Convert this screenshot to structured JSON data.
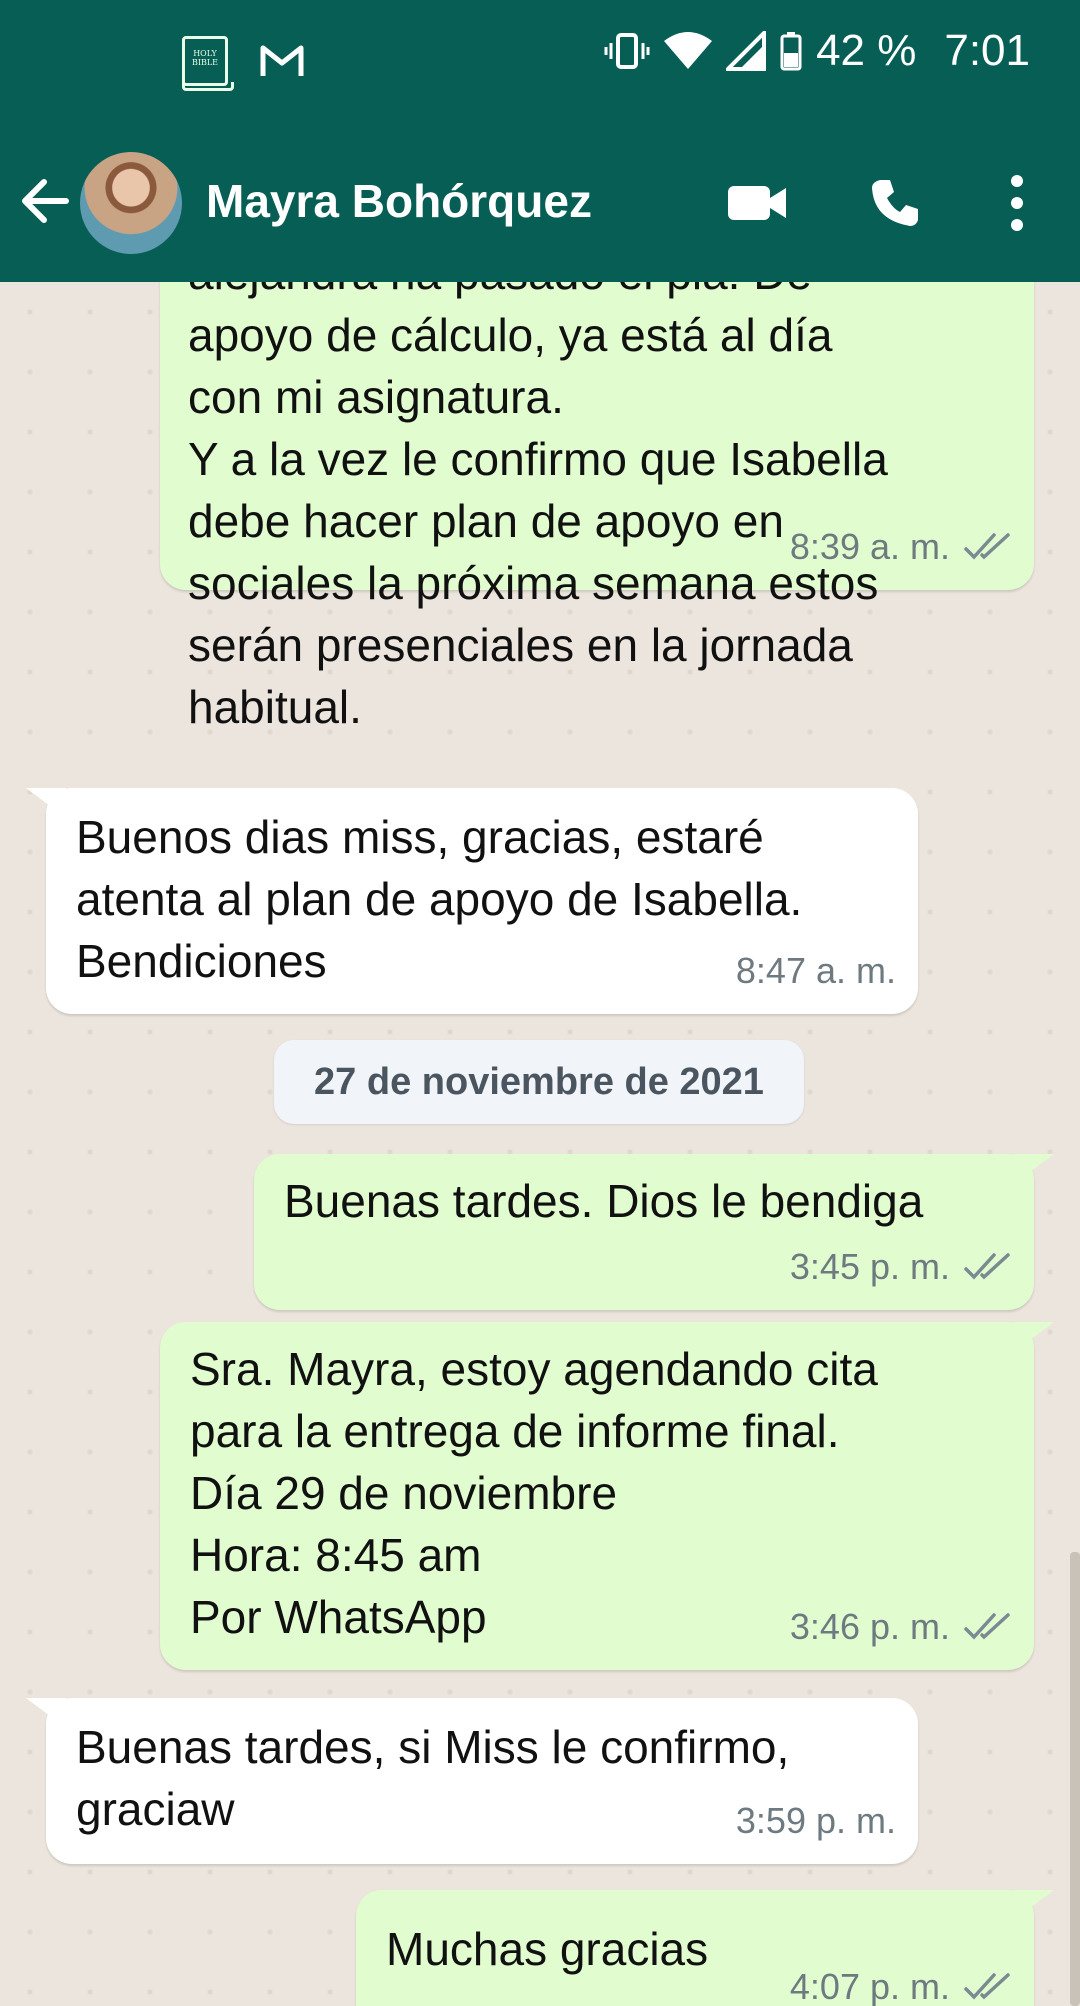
{
  "status_bar": {
    "bible_icon_text": "HOLY BIBLE",
    "battery_text": "42 %",
    "time": "7:01"
  },
  "app_bar": {
    "contact_name": "Mayra Bohórquez"
  },
  "messages": [
    {
      "direction": "out",
      "text": "alejandra ha pasado el pla. De\napoyo de cálculo, ya está al día\ncon mi asignatura.\nY a la vez le confirmo que Isabella\ndebe hacer plan de apoyo en\nsociales la próxima semana estos\nserán presenciales en la jornada\nhabitual.",
      "time": "8:39 a. m."
    },
    {
      "direction": "in",
      "text": "Buenos dias miss, gracias, estaré\natenta al plan de apoyo de Isabella.\nBendiciones",
      "time": "8:47 a. m."
    },
    {
      "direction": "out",
      "text": "Buenas tardes. Dios le bendiga",
      "time": "3:45 p. m."
    },
    {
      "direction": "out",
      "text": "Sra. Mayra, estoy agendando cita\npara la entrega de informe final.\nDía 29 de noviembre\nHora: 8:45 am\nPor WhatsApp",
      "time": "3:46 p. m."
    },
    {
      "direction": "in",
      "text": "Buenas tardes, si Miss le confirmo,\ngraciaw",
      "time": "3:59 p. m."
    },
    {
      "direction": "out",
      "text": "Muchas gracias",
      "time": "4:07 p. m."
    }
  ],
  "date_separator": "27 de noviembre de 2021",
  "colors": {
    "header": "#075e54",
    "outgoing_bubble": "#e1fdd0",
    "incoming_bubble": "#ffffff",
    "chat_background": "#ece5dd"
  }
}
